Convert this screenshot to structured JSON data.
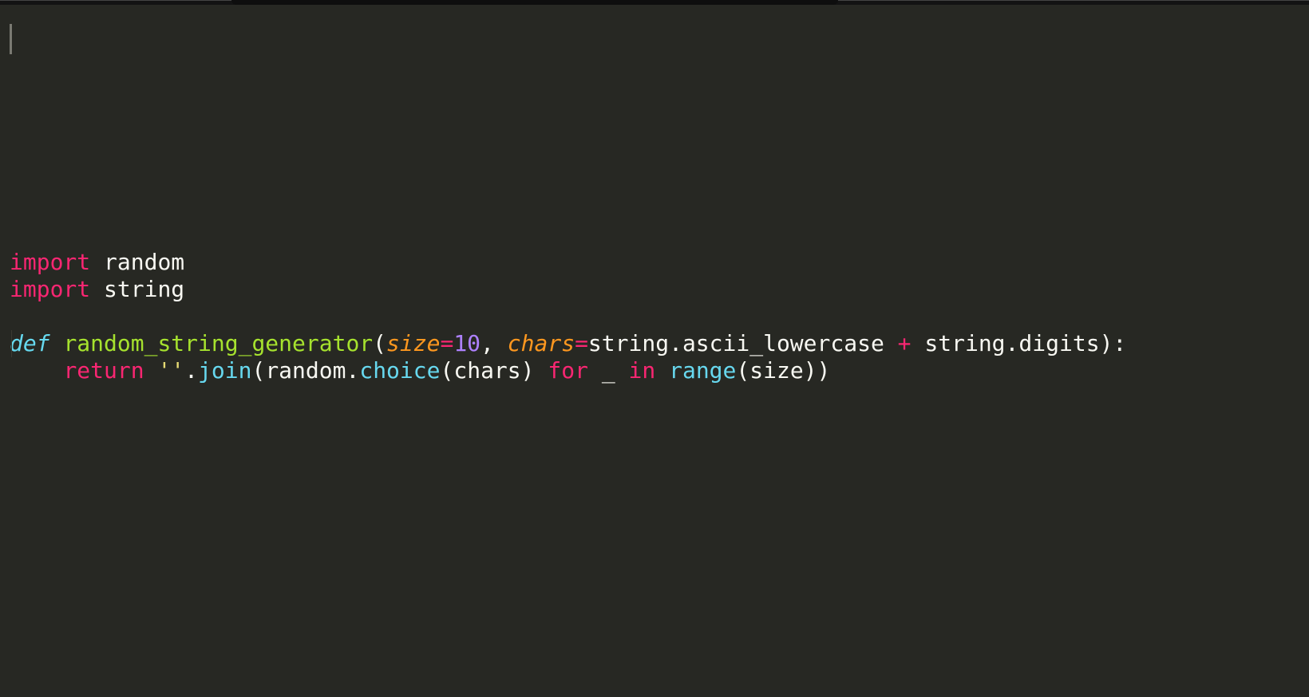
{
  "code": {
    "line1": {
      "kw": "import",
      "mod": "random"
    },
    "line2": {
      "kw": "import",
      "mod": "string"
    },
    "line4": {
      "kw": "def",
      "fn": "random_string_generator",
      "p1name": "size",
      "p1val": "10",
      "p2name": "chars",
      "p2val_a": "string",
      "p2val_b": "ascii_lowercase",
      "p2val_c": "string",
      "p2val_d": "digits"
    },
    "line5": {
      "kw": "return",
      "str": "''",
      "join": "join",
      "rand": "random",
      "choice": "choice",
      "charsArg": "chars",
      "for": "for",
      "uscore": "_",
      "in": "in",
      "range": "range",
      "sizeArg": "size"
    }
  },
  "colors": {
    "bg": "#272823",
    "keyword": "#f92672",
    "def": "#66d9ef",
    "string": "#e6db74",
    "func": "#a6e22e",
    "call": "#67d8ef",
    "param": "#fd971f",
    "number": "#ae81ff",
    "text": "#f8f8f2"
  }
}
